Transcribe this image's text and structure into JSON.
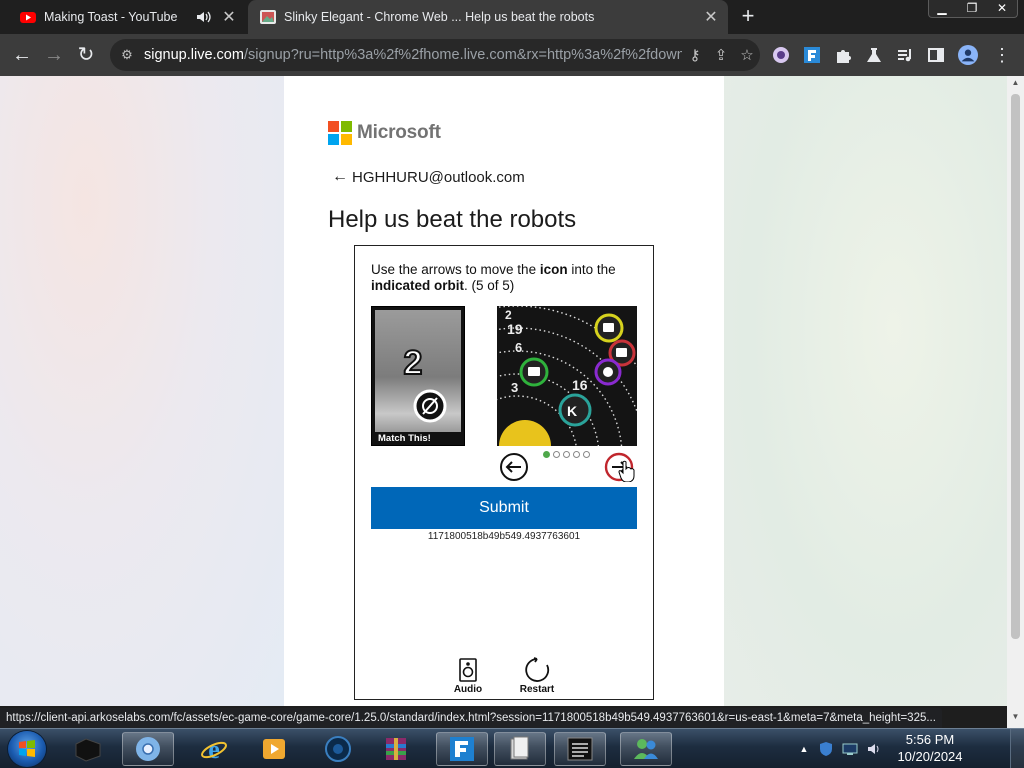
{
  "browser": {
    "tabs": [
      {
        "title": "Making Toast - YouTube",
        "favicon": "youtube-icon",
        "audio": true
      },
      {
        "title": "Slinky Elegant - Chrome Web ... Help us beat the robots",
        "favicon": "image-favicon-icon",
        "active": true
      }
    ],
    "new_tab_label": "+",
    "url_host": "signup.live.com",
    "url_path": "/signup?ru=http%3a%2f%2fhome.live.com&rx=http%3a%2f%2fdown...",
    "accent_color": "#0067b8"
  },
  "page": {
    "brand": "Microsoft",
    "back_email": "HGHHURU@outlook.com",
    "heading": "Help us beat the robots",
    "puzzle": {
      "instruction_part1": "Use the arrows to move the ",
      "instruction_bold1": "icon",
      "instruction_part2": " into the ",
      "instruction_bold2": "indicated orbit",
      "instruction_part3": ". (5 of 5)",
      "match_caption": "Match This!",
      "target_number": "2",
      "orbit_numbers": [
        "2",
        "19",
        "6",
        "3",
        "16"
      ],
      "selected_dot": 1,
      "dot_count": 5,
      "submit_label": "Submit",
      "session_id": "1171800518b49b549.4937763601",
      "audio_label": "Audio",
      "restart_label": "Restart"
    }
  },
  "statusbar": {
    "link": "https://client-api.arkoselabs.com/fc/assets/ec-game-core/game-core/1.25.0/standard/index.html?session=1171800518b49b549.4937763601&r=us-east-1&meta=7&meta_height=325..."
  },
  "taskbar": {
    "time": "5:56 PM",
    "date": "10/20/2024"
  }
}
